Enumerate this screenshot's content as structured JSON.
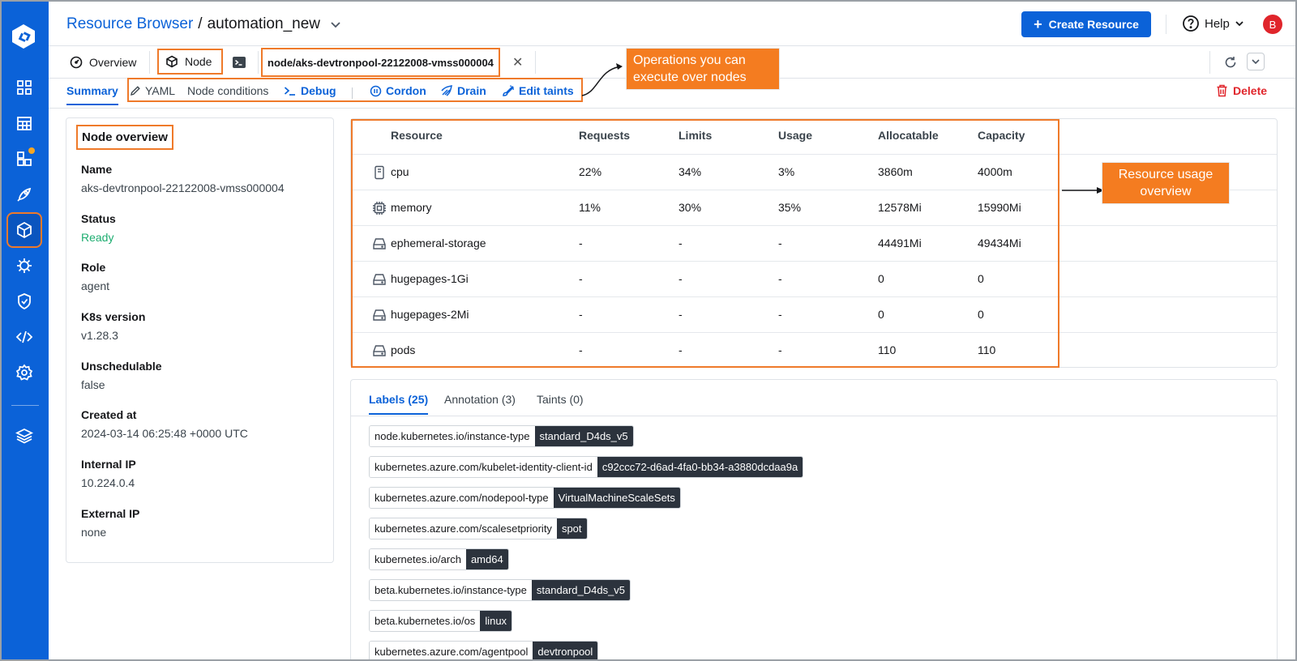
{
  "header": {
    "breadcrumb_link": "Resource Browser",
    "breadcrumb_sep": "/",
    "cluster": "automation_new",
    "create_label": "Create Resource",
    "help_label": "Help",
    "avatar_initial": "B"
  },
  "sidebar": {
    "items": [
      {
        "icon": "apps-grid-icon"
      },
      {
        "icon": "app-groups-icon"
      },
      {
        "icon": "charts-icon",
        "badge": true
      },
      {
        "icon": "deploy-rocket-icon"
      },
      {
        "icon": "resource-browser-cube-icon",
        "active": true
      },
      {
        "icon": "bug-icon"
      },
      {
        "icon": "security-shield-icon"
      },
      {
        "icon": "code-icon"
      },
      {
        "icon": "settings-gear-icon"
      },
      {
        "icon": "stack-layers-icon"
      }
    ]
  },
  "tabs": {
    "overview": "Overview",
    "node": "Node",
    "path": "node/aks-devtronpool-22122008-vmss000004"
  },
  "subbar": {
    "summary": "Summary",
    "yaml": "YAML",
    "conditions": "Node conditions",
    "debug": "Debug",
    "cordon": "Cordon",
    "drain": "Drain",
    "taints": "Edit taints",
    "delete": "Delete"
  },
  "overview": {
    "title": "Node overview",
    "fields": [
      {
        "key": "Name",
        "value": "aks-devtronpool-22122008-vmss000004"
      },
      {
        "key": "Status",
        "value": "Ready"
      },
      {
        "key": "Role",
        "value": "agent"
      },
      {
        "key": "K8s version",
        "value": "v1.28.3"
      },
      {
        "key": "Unschedulable",
        "value": "false"
      },
      {
        "key": "Created at",
        "value": "2024-03-14 06:25:48 +0000 UTC"
      },
      {
        "key": "Internal IP",
        "value": "10.224.0.4"
      },
      {
        "key": "External IP",
        "value": "none"
      }
    ]
  },
  "resources": {
    "columns": [
      "Resource",
      "Requests",
      "Limits",
      "Usage",
      "Allocatable",
      "Capacity"
    ],
    "rows": [
      {
        "icon": "cpu-icon",
        "name": "cpu",
        "requests": "22%",
        "limits": "34%",
        "usage": "3%",
        "allocatable": "3860m",
        "capacity": "4000m"
      },
      {
        "icon": "memory-chip-icon",
        "name": "memory",
        "requests": "11%",
        "limits": "30%",
        "usage": "35%",
        "allocatable": "12578Mi",
        "capacity": "15990Mi"
      },
      {
        "icon": "storage-drive-icon",
        "name": "ephemeral-storage",
        "requests": "-",
        "limits": "-",
        "usage": "-",
        "allocatable": "44491Mi",
        "capacity": "49434Mi"
      },
      {
        "icon": "storage-drive-icon",
        "name": "hugepages-1Gi",
        "requests": "-",
        "limits": "-",
        "usage": "-",
        "allocatable": "0",
        "capacity": "0"
      },
      {
        "icon": "storage-drive-icon",
        "name": "hugepages-2Mi",
        "requests": "-",
        "limits": "-",
        "usage": "-",
        "allocatable": "0",
        "capacity": "0"
      },
      {
        "icon": "storage-drive-icon",
        "name": "pods",
        "requests": "-",
        "limits": "-",
        "usage": "-",
        "allocatable": "110",
        "capacity": "110"
      }
    ]
  },
  "labels_section": {
    "tabs": [
      "Labels (25)",
      "Annotation (3)",
      "Taints (0)"
    ],
    "labels": [
      {
        "key": "node.kubernetes.io/instance-type",
        "value": "standard_D4ds_v5"
      },
      {
        "key": "kubernetes.azure.com/kubelet-identity-client-id",
        "value": "c92ccc72-d6ad-4fa0-bb34-a3880dcdaa9a"
      },
      {
        "key": "kubernetes.azure.com/nodepool-type",
        "value": "VirtualMachineScaleSets"
      },
      {
        "key": "kubernetes.azure.com/scalesetpriority",
        "value": "spot"
      },
      {
        "key": "kubernetes.io/arch",
        "value": "amd64"
      },
      {
        "key": "beta.kubernetes.io/instance-type",
        "value": "standard_D4ds_v5"
      },
      {
        "key": "beta.kubernetes.io/os",
        "value": "linux"
      },
      {
        "key": "kubernetes.azure.com/agentpool",
        "value": "devtronpool"
      }
    ]
  },
  "annotations": {
    "operations": [
      "Operations you can",
      "execute over nodes"
    ],
    "resource_usage": [
      "Resource usage",
      "overview"
    ]
  },
  "colors": {
    "brand": "#0b62d8",
    "highlight": "#ef7a2a",
    "success": "#1dad70",
    "danger": "#e0252b"
  }
}
